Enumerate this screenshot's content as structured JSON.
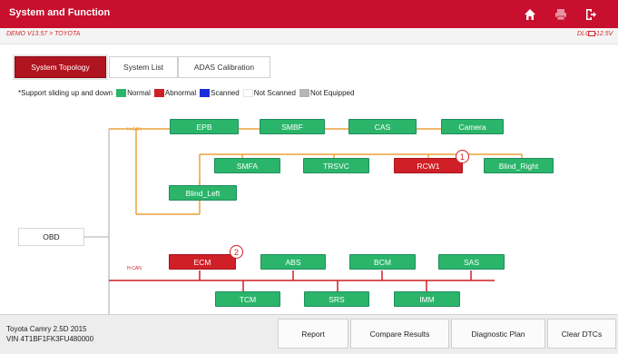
{
  "app": {
    "title": "System and Function"
  },
  "toolbar": {
    "home_icon": "home-icon",
    "print_icon": "print-icon",
    "exit_icon": "exit-icon"
  },
  "subheader": {
    "demo": "DEMO V13.57 > TOYOTA",
    "dlc": "DLC",
    "voltage": "12.5V"
  },
  "tabs": [
    {
      "label": "System Topology",
      "active": true
    },
    {
      "label": "System List",
      "active": false
    },
    {
      "label": "ADAS Calibration",
      "active": false
    }
  ],
  "legend": {
    "note": "*Support sliding up and down",
    "items": [
      {
        "label": "Normal",
        "color": "#2bb56a"
      },
      {
        "label": "Abnormal",
        "color": "#d11f27"
      },
      {
        "label": "Scanned",
        "color": "#1a2bd8"
      },
      {
        "label": "Not Scanned",
        "color": "#ffffff"
      },
      {
        "label": "Not Equipped",
        "color": "#b5b5b5"
      }
    ]
  },
  "topology": {
    "root": "OBD",
    "bus_labels": {
      "upper": "H-CAN",
      "lower": "H-CAN"
    },
    "modules": {
      "epb": "EPB",
      "smbf": "SMBF",
      "cas": "CAS",
      "camera": "Camera",
      "smfa": "SMFA",
      "trsvc": "TRSVC",
      "rcw1": "RCW1",
      "blind_right": "Blind_Right",
      "blind_left": "Blind_Left",
      "ecm": "ECM",
      "abs": "ABS",
      "bcm": "BCM",
      "sas": "SAS",
      "tcm": "TCM",
      "srs": "SRS",
      "imm": "IMM"
    },
    "badges": {
      "rcw1": "1",
      "ecm": "2"
    }
  },
  "vehicle": {
    "model": "Toyota Camry 2.5D 2015",
    "vin": "VIN 4T1BF1FK3FU480000"
  },
  "actions": {
    "report": "Report",
    "compare": "Compare Results",
    "plan": "Diagnostic Plan",
    "clear": "Clear DTCs"
  }
}
